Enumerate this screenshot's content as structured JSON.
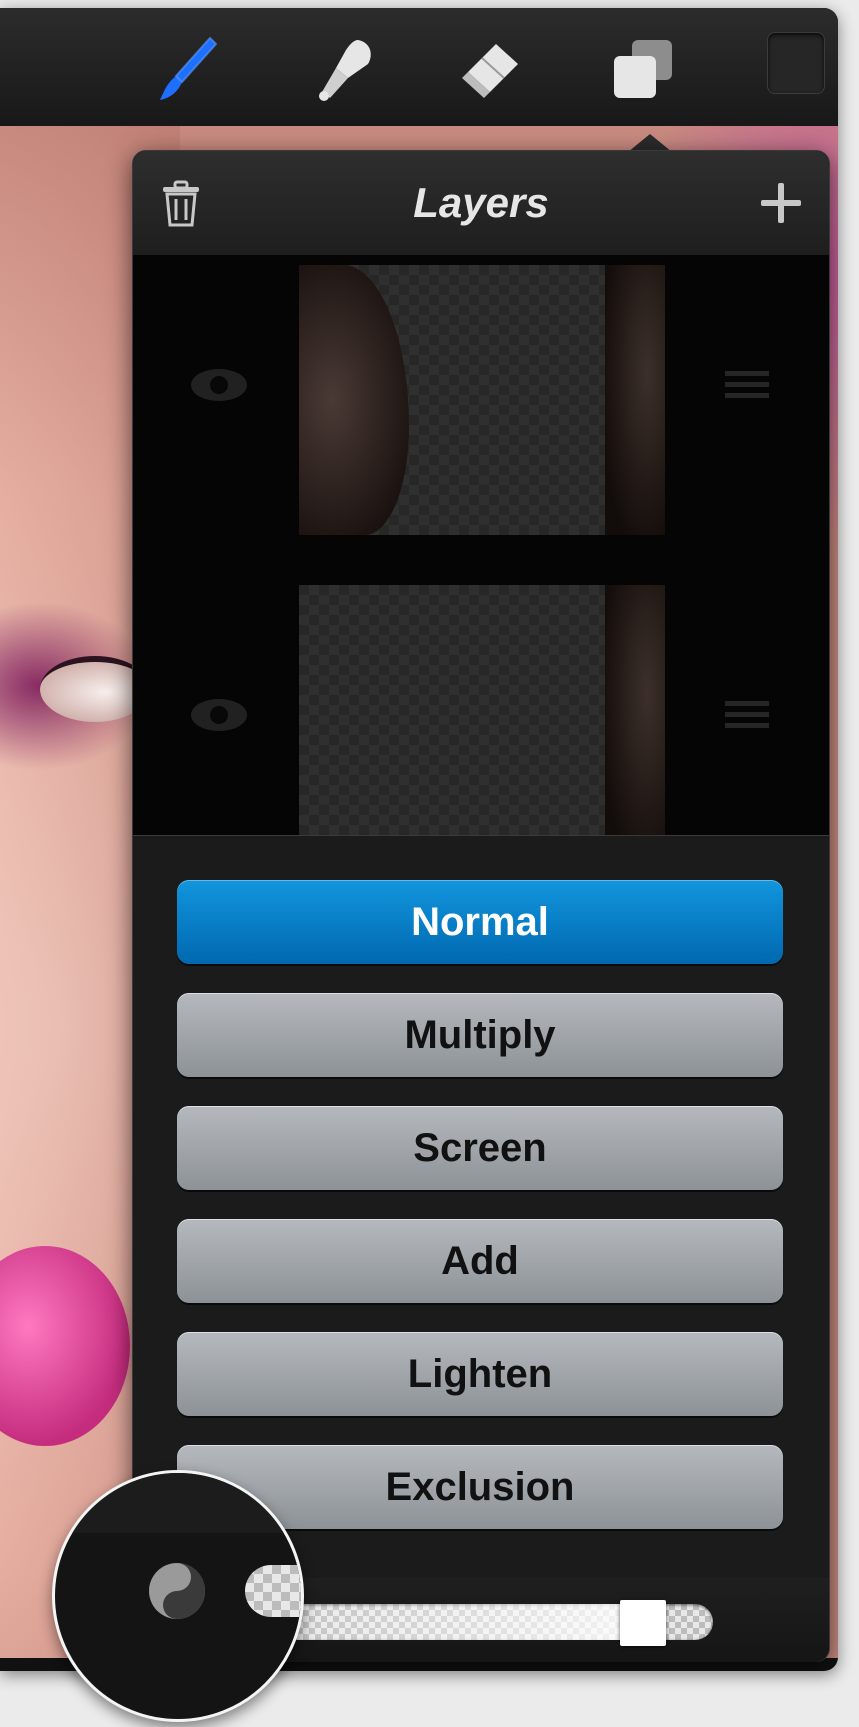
{
  "toolbar": {
    "tools": [
      {
        "name": "brush-tool",
        "icon": "brush-icon",
        "active": true,
        "color": "#1e6fff"
      },
      {
        "name": "smudge-tool",
        "icon": "smudge-icon",
        "active": false,
        "color": "#e6e6e6"
      },
      {
        "name": "eraser-tool",
        "icon": "eraser-icon",
        "active": false,
        "color": "#e6e6e6"
      },
      {
        "name": "layers-tool",
        "icon": "layers-icon",
        "active": false,
        "color": "#e6e6e6"
      }
    ],
    "color_swatch": "#262626"
  },
  "layers_panel": {
    "title": "Layers",
    "delete_icon": "trash-icon",
    "add_icon": "plus-icon"
  },
  "blend_modes": {
    "selected": "Normal",
    "options": [
      "Normal",
      "Multiply",
      "Screen",
      "Add",
      "Lighten",
      "Exclusion"
    ],
    "selected_color": "#0a7fcc"
  },
  "opacity": {
    "icon": "blend-mode-icon",
    "value": 0.85
  }
}
